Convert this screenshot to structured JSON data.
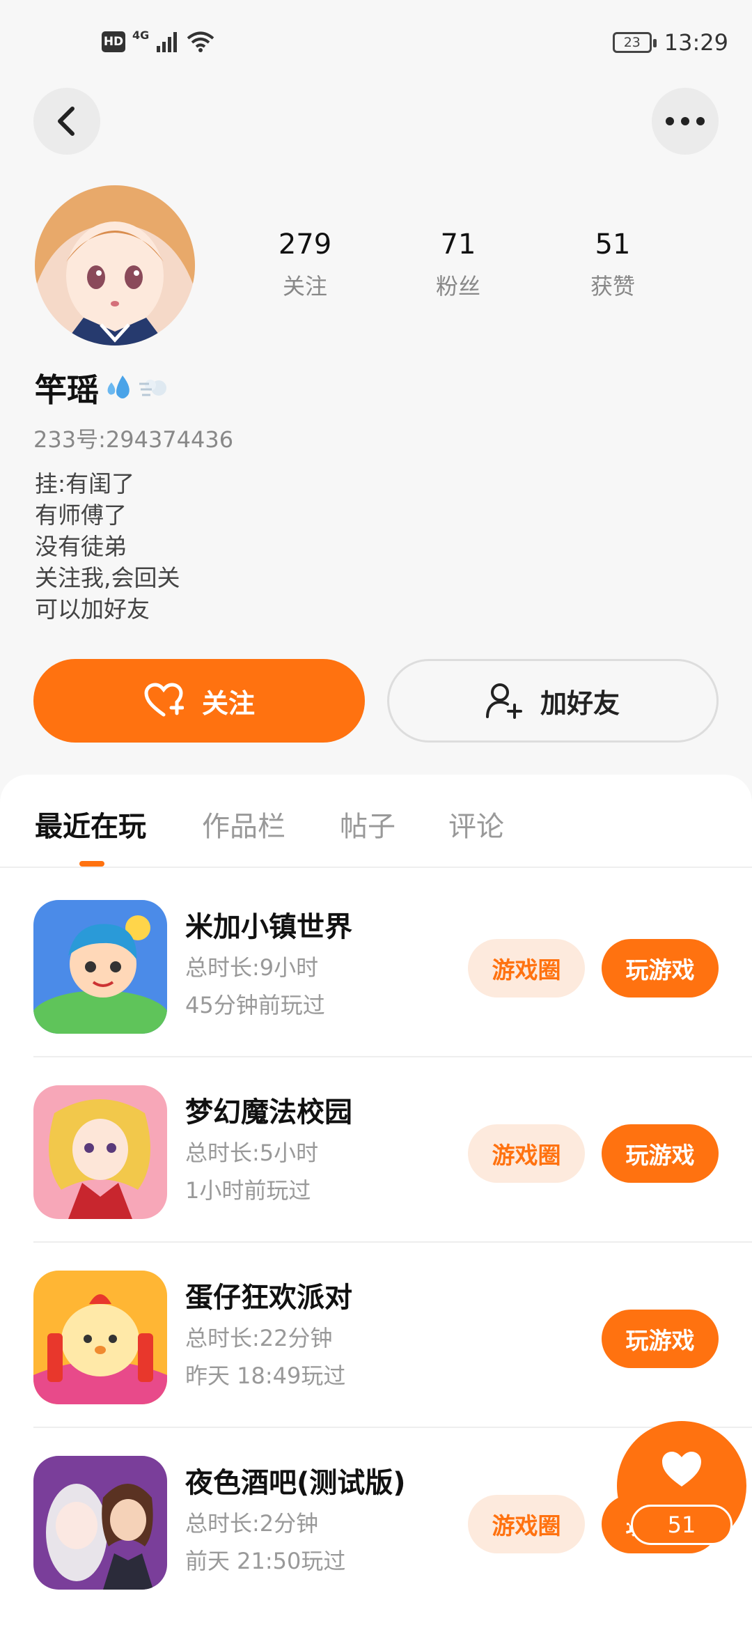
{
  "status_bar": {
    "hd": "HD",
    "network": "4G",
    "battery": "23",
    "time": "13:29"
  },
  "profile": {
    "stats": [
      {
        "value": "279",
        "label": "关注"
      },
      {
        "value": "71",
        "label": "粉丝"
      },
      {
        "value": "51",
        "label": "获赞"
      }
    ],
    "nickname": "竿瑶",
    "uid": "233号:294374436",
    "bio": [
      "挂:有闺了",
      "有师傅了",
      "没有徒弟",
      "关注我,会回关",
      "可以加好友"
    ]
  },
  "actions": {
    "follow": "关注",
    "add_friend": "加好友"
  },
  "tabs": [
    "最近在玩",
    "作品栏",
    "帖子",
    "评论"
  ],
  "games": [
    {
      "name": "米加小镇世界",
      "duration": "总时长:9小时",
      "last_played": "45分钟前玩过",
      "circle": "游戏圈",
      "play": "玩游戏"
    },
    {
      "name": "梦幻魔法校园",
      "duration": "总时长:5小时",
      "last_played": "1小时前玩过",
      "circle": "游戏圈",
      "play": "玩游戏"
    },
    {
      "name": "蛋仔狂欢派对",
      "duration": "总时长:22分钟",
      "last_played": "昨天 18:49玩过",
      "play": "玩游戏"
    },
    {
      "name": "夜色酒吧(测试版)",
      "duration": "总时长:2分钟",
      "last_played": "前天 21:50玩过",
      "circle": "游戏圈",
      "play": "玩游戏"
    }
  ],
  "fab": {
    "count": "51"
  },
  "colors": {
    "accent": "#ff7210",
    "accent_light": "#fdeadd",
    "text_muted": "#888888"
  }
}
